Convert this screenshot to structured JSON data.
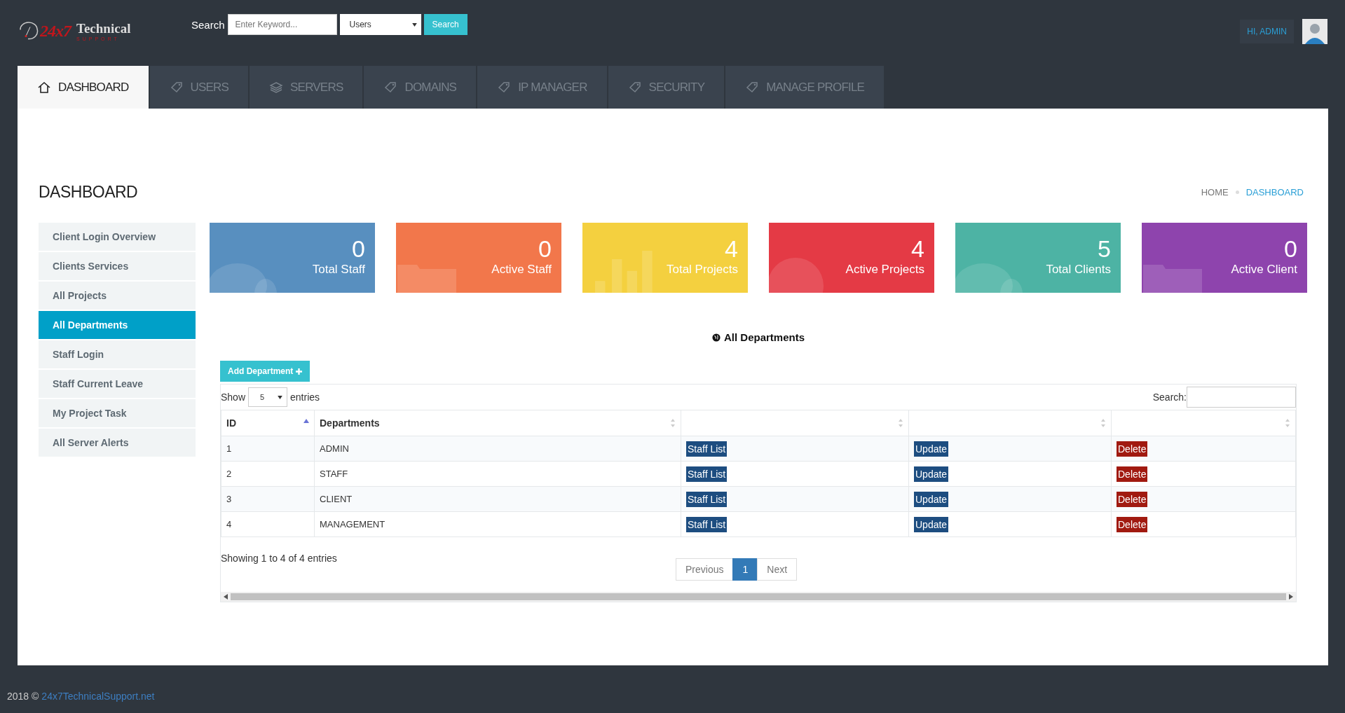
{
  "logo": {
    "mark": "24x7",
    "name": "Technical",
    "tagline": "SUPPORT"
  },
  "search": {
    "label": "Search",
    "placeholder": "Enter Keyword...",
    "scope": "Users",
    "button": "Search"
  },
  "user": {
    "greeting": "HI, ADMIN"
  },
  "tabs": [
    {
      "label": "DASHBOARD",
      "selected": true,
      "kind": "home"
    },
    {
      "label": "USERS",
      "selected": false,
      "kind": "tag"
    },
    {
      "label": "SERVERS",
      "selected": false,
      "kind": "layers"
    },
    {
      "label": "DOMAINS",
      "selected": false,
      "kind": "tag"
    },
    {
      "label": "IP MANAGER",
      "selected": false,
      "kind": "tag"
    },
    {
      "label": "SECURITY",
      "selected": false,
      "kind": "tag"
    },
    {
      "label": "MANAGE PROFILE",
      "selected": false,
      "kind": "tag"
    }
  ],
  "page_title": "DASHBOARD",
  "breadcrumb": [
    "HOME",
    "DASHBOARD"
  ],
  "sidebar": {
    "items": [
      {
        "label": "Client Login Overview",
        "selected": false
      },
      {
        "label": "Clients Services",
        "selected": false
      },
      {
        "label": "All Projects",
        "selected": false
      },
      {
        "label": "All Departments",
        "selected": true
      },
      {
        "label": "Staff Login",
        "selected": false
      },
      {
        "label": "Staff Current Leave",
        "selected": false
      },
      {
        "label": "My Project Task",
        "selected": false
      },
      {
        "label": "All Server Alerts",
        "selected": false
      }
    ]
  },
  "stats": [
    {
      "value": "0",
      "label": "Total Staff",
      "color": "#588fbf",
      "kind": "bubbles"
    },
    {
      "value": "0",
      "label": "Active Staff",
      "color": "#f2774b",
      "kind": "folder"
    },
    {
      "value": "4",
      "label": "Total Projects",
      "color": "#f4d03f",
      "kind": "bars"
    },
    {
      "value": "4",
      "label": "Active Projects",
      "color": "#e43a45",
      "kind": "globe"
    },
    {
      "value": "5",
      "label": "Total Clients",
      "color": "#4db3a4",
      "kind": "bubbles"
    },
    {
      "value": "0",
      "label": "Active Client",
      "color": "#8e44ad",
      "kind": "folder"
    }
  ],
  "section_title": "All Departments",
  "add_button": "Add Department",
  "table": {
    "show_label": "Show",
    "page_size": "5",
    "entries_label": "entries",
    "search_label": "Search:",
    "columns": [
      {
        "label": "ID",
        "sorted": true
      },
      {
        "label": "Departments",
        "sorted": false
      },
      {
        "sorted": false
      },
      {
        "sorted": false
      },
      {
        "sorted": false
      }
    ],
    "rows": [
      {
        "id": "1",
        "name": "ADMIN",
        "staff": "Staff List",
        "update": "Update",
        "delete": "Delete"
      },
      {
        "id": "2",
        "name": "STAFF",
        "staff": "Staff List",
        "update": "Update",
        "delete": "Delete"
      },
      {
        "id": "3",
        "name": "CLIENT",
        "staff": "Staff List",
        "update": "Update",
        "delete": "Delete"
      },
      {
        "id": "4",
        "name": "MANAGEMENT",
        "staff": "Staff List",
        "update": "Update",
        "delete": "Delete"
      }
    ],
    "info": "Showing 1 to 4 of 4 entries",
    "pagination": [
      {
        "label": "Previous",
        "selected": false
      },
      {
        "label": "1",
        "selected": true
      },
      {
        "label": "Next",
        "selected": false
      }
    ]
  },
  "footer": {
    "year": "2018 ©",
    "link": "24x7TechnicalSupport.net"
  }
}
